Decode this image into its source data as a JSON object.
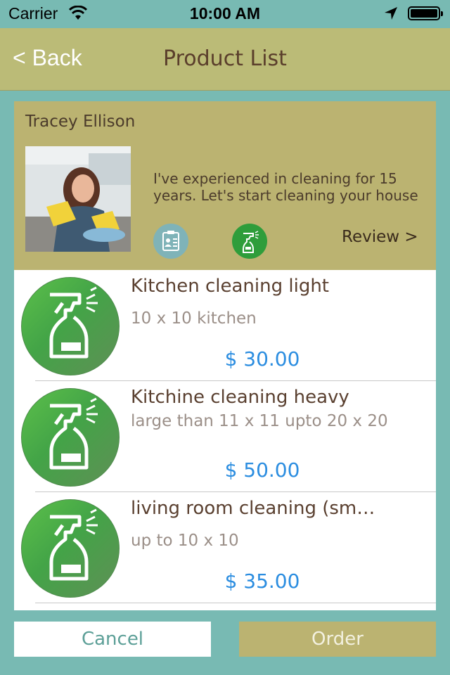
{
  "status_bar": {
    "carrier": "Carrier",
    "time": "10:00 AM"
  },
  "nav": {
    "back_label": "< Back",
    "title": "Product List"
  },
  "profile": {
    "name": "Tracey Ellison",
    "description": "I've experienced in cleaning for 15 years. Let's start cleaning your house",
    "review_label": "Review >",
    "icons": [
      "id-card-icon",
      "spray-bottle-icon"
    ]
  },
  "products": [
    {
      "title": "Kitchen cleaning light",
      "subtitle": "10 x 10 kitchen",
      "price": "$ 30.00",
      "icon": "spray-bottle-icon"
    },
    {
      "title": "Kitchine cleaning heavy",
      "subtitle": "large than 11 x 11 upto 20 x 20",
      "price": "$ 50.00",
      "icon": "spray-bottle-icon"
    },
    {
      "title": "living room cleaning (sm…",
      "subtitle": "up to 10 x 10",
      "price": "$ 35.00",
      "icon": "spray-bottle-icon"
    }
  ],
  "buttons": {
    "cancel": "Cancel",
    "order": "Order"
  },
  "colors": {
    "background": "#78bab3",
    "bar": "#bbbb77",
    "price": "#2b8de0",
    "icon_green": "#43a447"
  }
}
